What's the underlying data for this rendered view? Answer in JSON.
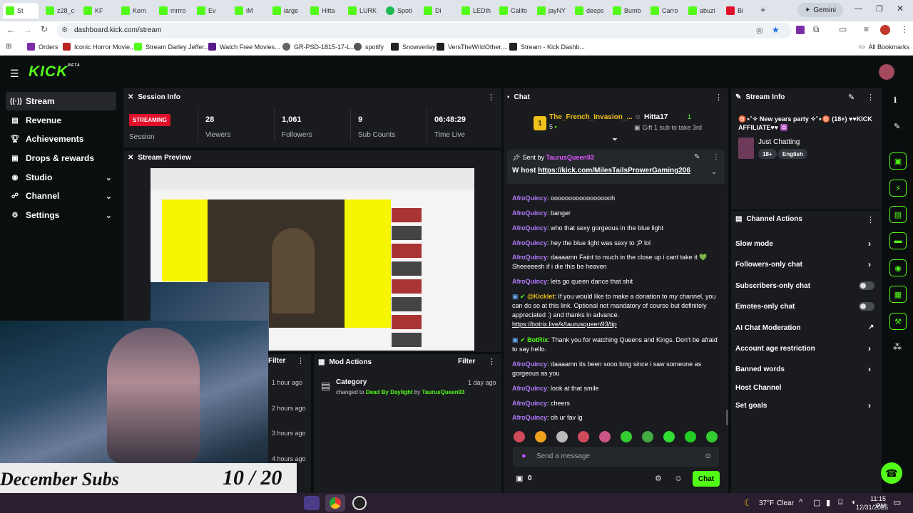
{
  "browser": {
    "tabs": [
      "St",
      "z28_c",
      "KF",
      "Kern",
      "mrrro",
      "Ev",
      "iM",
      "iarge",
      "Hitta",
      "LURK",
      "Spoti",
      "Di",
      "LEDth",
      "Califo",
      "jayNY",
      "deeps",
      "Bumb",
      "Carro",
      "abuzi",
      "Bi"
    ],
    "gemini_label": "Gemini",
    "url": "dashboard.kick.com/stream",
    "bookmarks": [
      "Orders",
      "Iconic Horror Movie...",
      "Stream Darley Jeffer...",
      "Watch Free Movies...",
      "GR-PSD-1815-17-L...",
      "spotify",
      "Snowverlay",
      "VersTheWrldOther,...",
      "Stream - Kick Dashb..."
    ],
    "all_bookmarks_label": "All Bookmarks"
  },
  "kick": {
    "logo": "KICK",
    "logo_badge": "BETA",
    "nav": [
      {
        "label": "Stream",
        "icon": "stream-icon"
      },
      {
        "label": "Revenue",
        "icon": "revenue-icon"
      },
      {
        "label": "Achievements",
        "icon": "trophy-icon"
      },
      {
        "label": "Drops & rewards",
        "icon": "gift-icon"
      },
      {
        "label": "Studio",
        "icon": "studio-icon"
      },
      {
        "label": "Channel",
        "icon": "channel-icon"
      },
      {
        "label": "Settings",
        "icon": "gear-icon"
      }
    ],
    "session": {
      "title": "Session Info",
      "status_badge": "STREAMING",
      "status_label": "Session",
      "stats": [
        {
          "value": "28",
          "label": "Viewers"
        },
        {
          "value": "1,061",
          "label": "Followers"
        },
        {
          "value": "9",
          "label": "Sub Counts"
        },
        {
          "value": "06:48:29",
          "label": "Time Live"
        }
      ]
    },
    "preview": {
      "title": "Stream Preview"
    },
    "overlay": {
      "subs_label": "December Subs",
      "subs_count": "10 / 20",
      "progress": 0.5
    },
    "activity": {
      "filter_label": "Filter",
      "times": [
        "1 hour ago",
        "2 hours ago",
        "3 hours ago",
        "4 hours ago"
      ]
    },
    "mod_actions": {
      "title": "Mod Actions",
      "filter_label": "Filter",
      "entry": {
        "title": "Category",
        "prefix": "changed to",
        "category": "Dead By Daylight",
        "by": "by",
        "user": "TaurusQueen93",
        "time": "1 day ago"
      }
    },
    "chat": {
      "title": "Chat",
      "leaderboard": [
        {
          "rank": "1",
          "name": "The_French_Invasion_...",
          "count": "5"
        },
        {
          "name": "Hitta17",
          "count": "1",
          "note": "Gift 1 sub to take 3rd"
        }
      ],
      "pinned": {
        "sent_by_label": "Sent by",
        "sender": "TaurusQueen93",
        "text": "W host",
        "link": "https://kick.com/MilesTailsProwerGaming206"
      },
      "messages": [
        {
          "user": "AfroQuincy",
          "text": "oooooooooooooooooh"
        },
        {
          "user": "AfroQuincy",
          "text": "banger"
        },
        {
          "user": "AfroQuincy",
          "text": "who that sexy gorgeous in the blue light"
        },
        {
          "user": "AfroQuincy",
          "text": "hey the blue light was sexy to ;P lol"
        },
        {
          "user": "AfroQuincy",
          "text": "daaaamn Faint to much in the close up i cant take it 💚 Sheeeeesh if i die this be heaven"
        },
        {
          "user": "AfroQuincy",
          "text": "lets go queen dance that shit"
        },
        {
          "user": "@Kicklet",
          "text": "If you would like to make a donation to my channel, you can do so at this link. Optional not mandatory of course but definitely appreciated :) and thanks in advance.",
          "link": "https://botrix.live/k/taurusqueen93/tip"
        },
        {
          "user": "BotRix",
          "text": "Thank you for watching Queens and Kings. Don't be afraid to say hello."
        },
        {
          "user": "AfroQuincy",
          "text": "daaaamn its been sooo long since i saw someone as gorgeous as you"
        },
        {
          "user": "AfroQuincy",
          "text": "look at that smile"
        },
        {
          "user": "AfroQuincy",
          "text": "cheers"
        },
        {
          "user": "AfroQuincy",
          "text": "oh ur fav lg"
        }
      ],
      "input_placeholder": "Send a message",
      "points": "0",
      "send_label": "Chat"
    },
    "stream_info": {
      "title": "Stream Info",
      "stream_title": "♉⋆˚✧ New years party ✧˚⋆♉ (18+) ♥♥KICK AFFILIATE♥♥ 🔯",
      "category": "Just Chatting",
      "tags": [
        "18+",
        "English"
      ]
    },
    "channel_actions": {
      "title": "Channel Actions",
      "items": [
        "Slow mode",
        "Followers-only chat",
        "Subscribers-only chat",
        "Emotes-only chat",
        "AI Chat Moderation",
        "Account age restriction",
        "Banned words",
        "Host Channel",
        "Set goals"
      ]
    }
  },
  "taskbar": {
    "weather_temp": "37°F",
    "weather_label": "Clear",
    "time": "11:15 PM",
    "date": "12/31/2025"
  },
  "colors": {
    "accent": "#53fc18",
    "streaming_badge": "#e0102a",
    "username": "#b57cff",
    "panel": "#191b1f"
  }
}
